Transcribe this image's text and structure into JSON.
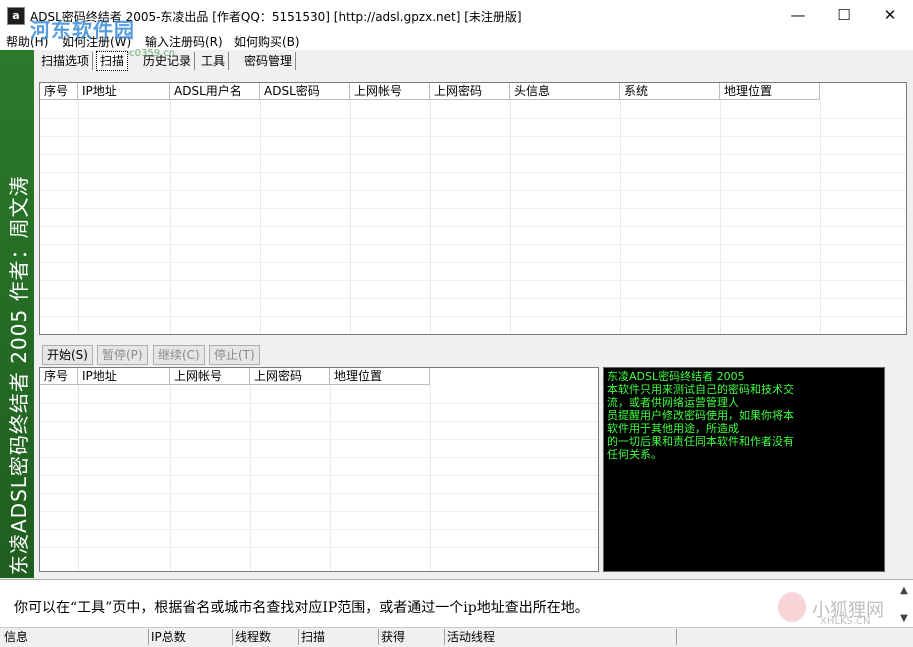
{
  "window": {
    "title": "ADSL密码终结者 2005-东凌出品 [作者QQ：5151530] [http://adsl.gpzx.net] [未注册版]",
    "icon_letter": "a",
    "minimize_glyph": "—",
    "maximize_glyph": "☐",
    "close_glyph": "✕"
  },
  "watermark": {
    "site_name": "河东软件园",
    "site_url": "www.pc0359.cn",
    "fox_name": "小狐狸网",
    "fox_url": "XHLKS.CN"
  },
  "menu": {
    "items": [
      {
        "label": "帮助(H)"
      },
      {
        "label": "如何注册(W)"
      },
      {
        "label": "输入注册码(R)"
      },
      {
        "label": "如何购买(B)"
      }
    ]
  },
  "sidebar": {
    "text": "东凌ADSL密码终结者 2005 作者：周文涛"
  },
  "tabs": [
    {
      "label": "扫描选项"
    },
    {
      "label": "扫描",
      "active": true
    },
    {
      "label": "历史记录"
    },
    {
      "label": "工具"
    },
    {
      "label": "密码管理"
    }
  ],
  "results_table": {
    "columns": [
      "序号",
      "IP地址",
      "ADSL用户名",
      "ADSL密码",
      "上网帐号",
      "上网密码",
      "头信息",
      "系统",
      "地理位置"
    ],
    "rows": []
  },
  "controls": {
    "start": "开始(S)",
    "pause": "暂停(P)",
    "resume": "继续(C)",
    "stop": "停止(T)"
  },
  "accounts_table": {
    "columns": [
      "序号",
      "IP地址",
      "上网帐号",
      "上网密码",
      "地理位置"
    ],
    "rows": []
  },
  "console": {
    "lines": [
      "东凌ADSL密码终结者 2005",
      "本软件只用来测试自己的密码和技术交",
      "流，或者供网络运营管理人",
      "员提醒用户修改密码使用，如果你将本",
      "软件用于其他用途，所造成",
      "的一切后果和责任同本软件和作者没有",
      "任何关系。"
    ],
    "text_color": "#41ff41",
    "background": "#000000"
  },
  "info_bar": {
    "text": "你可以在“工具”页中，根据省名或城市名查找对应IP范围，或者通过一个ip地址查出所在地。"
  },
  "status_bar": {
    "cells": [
      "信息",
      "IP总数",
      "线程数",
      "扫描",
      "获得",
      "活动线程",
      ""
    ]
  },
  "colors": {
    "sidebar_green": "#2b7a2b",
    "console_green": "#41ff41"
  }
}
